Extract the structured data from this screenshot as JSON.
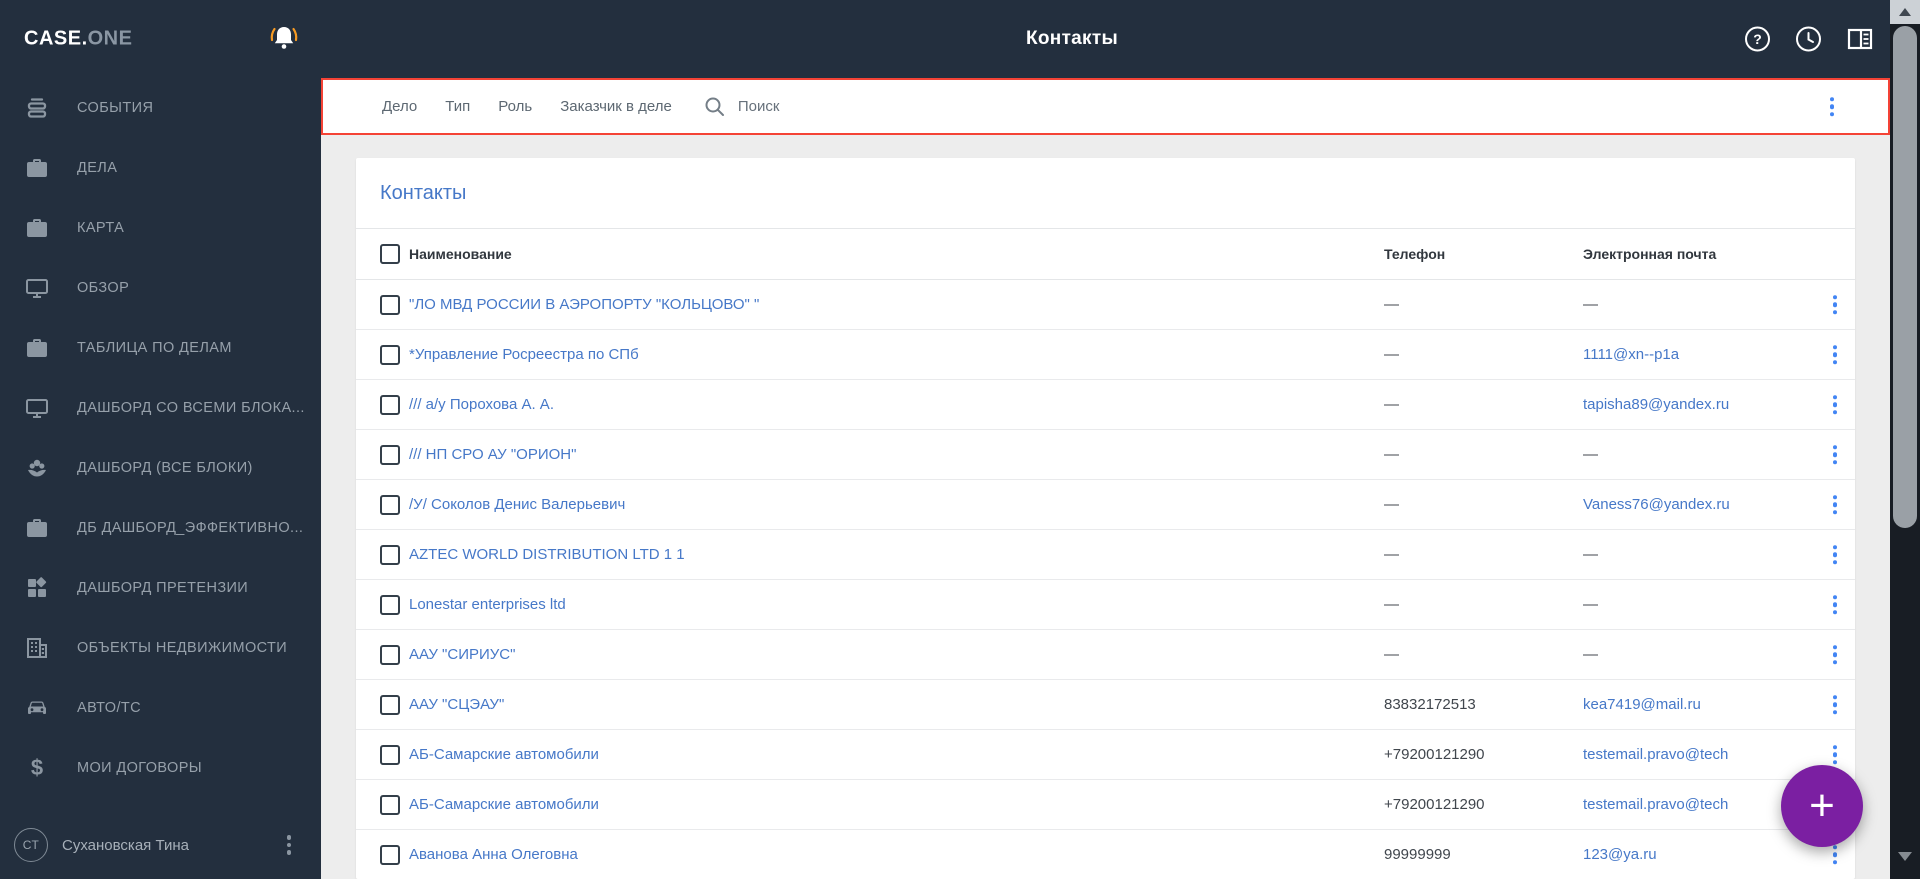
{
  "topbar": {
    "brand_primary": "CASE.",
    "brand_secondary": "ONE",
    "title": "Контакты"
  },
  "sidebar": {
    "items": [
      {
        "icon": "events-icon",
        "label": "СОБЫТИЯ"
      },
      {
        "icon": "briefcase-icon",
        "label": "ДЕЛА"
      },
      {
        "icon": "briefcase-icon",
        "label": "КАРТА"
      },
      {
        "icon": "monitor-icon",
        "label": "ОБЗОР"
      },
      {
        "icon": "briefcase-icon",
        "label": "ТАБЛИЦА ПО ДЕЛАМ"
      },
      {
        "icon": "monitor-icon",
        "label": "ДАШБОРД СО ВСЕМИ БЛОКА..."
      },
      {
        "icon": "flower-icon",
        "label": "ДАШБОРД (ВСЕ БЛОКИ)"
      },
      {
        "icon": "briefcase-icon",
        "label": "ДБ ДАШБОРД_ЭФФЕКТИВНО..."
      },
      {
        "icon": "dashboard-icon",
        "label": "ДАШБОРД ПРЕТЕНЗИИ"
      },
      {
        "icon": "building-icon",
        "label": "ОБЪЕКТЫ НЕДВИЖИМОСТИ"
      },
      {
        "icon": "car-icon",
        "label": "АВТО/ТС"
      },
      {
        "icon": "dollar-icon",
        "label": "МОИ ДОГОВОРЫ"
      }
    ],
    "user": {
      "initials": "СТ",
      "name": "Сухановская Тина"
    }
  },
  "filterbar": {
    "filters": [
      "Дело",
      "Тип",
      "Роль",
      "Заказчик в деле"
    ],
    "search_placeholder": "Поиск"
  },
  "content": {
    "title": "Контакты",
    "columns": {
      "name": "Наименование",
      "phone": "Телефон",
      "email": "Электронная почта"
    },
    "empty_value": "—",
    "rows": [
      {
        "name": "\"ЛО МВД РОССИИ В АЭРОПОРТУ \"КОЛЬЦОВО\" \"",
        "phone": "—",
        "email": "—"
      },
      {
        "name": "*Управление Росреестра по СПб",
        "phone": "—",
        "email": "1111@xn--p1a"
      },
      {
        "name": "/// а/у Порохова А. А.",
        "phone": "—",
        "email": "tapisha89@yandex.ru"
      },
      {
        "name": "/// НП СРО АУ \"ОРИОН\"",
        "phone": "—",
        "email": "—"
      },
      {
        "name": "/У/ Соколов Денис Валерьевич",
        "phone": "—",
        "email": "Vaness76@yandex.ru"
      },
      {
        "name": "AZTEC WORLD DISTRIBUTION LTD 1 1",
        "phone": "—",
        "email": "—"
      },
      {
        "name": "Lonestar enterprises ltd",
        "phone": "—",
        "email": "—"
      },
      {
        "name": "ААУ \"СИРИУС\"",
        "phone": "—",
        "email": "—"
      },
      {
        "name": "ААУ \"СЦЭАУ\"",
        "phone": "83832172513",
        "email": "kea7419@mail.ru"
      },
      {
        "name": "АБ-Самарские автомобили",
        "phone": "+79200121290",
        "email": "testemail.pravo@tech"
      },
      {
        "name": "АБ-Самарские автомобили",
        "phone": "+79200121290",
        "email": "testemail.pravo@tech"
      },
      {
        "name": "Аванова Анна Олеговна",
        "phone": "99999999",
        "email": "123@ya.ru"
      }
    ]
  },
  "fab": {
    "label": "+"
  },
  "colors": {
    "accent_red": "#f44336",
    "link_blue": "#4678c8",
    "kebab_blue": "#4285f4",
    "fab_purple": "#7b1fa2",
    "dark_navy": "#232f3e"
  }
}
